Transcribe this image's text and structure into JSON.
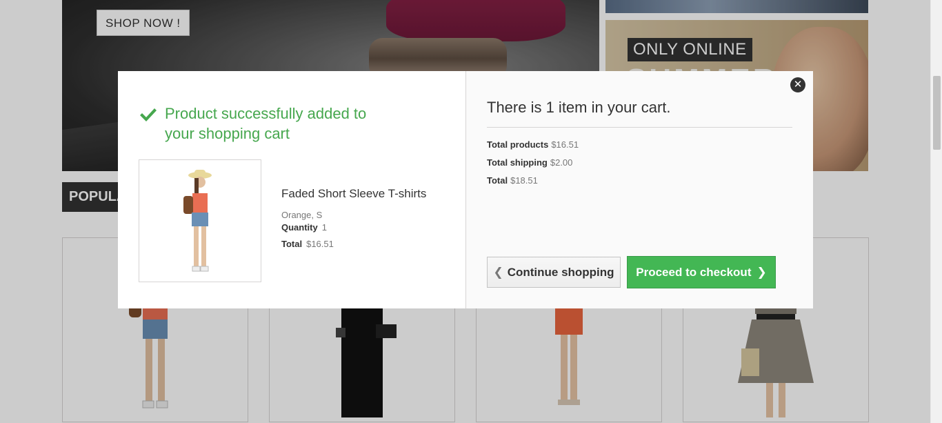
{
  "background": {
    "shop_now_label": "SHOP NOW !",
    "only_online_label": "ONLY ONLINE",
    "summer_label": "SUMMER",
    "popular_tab_label": "POPULAR"
  },
  "modal": {
    "success_message": "Product successfully added to your shopping cart",
    "product": {
      "name": "Faded Short Sleeve T-shirts",
      "attributes": "Orange, S",
      "quantity_label": "Quantity",
      "quantity_value": "1",
      "total_label": "Total",
      "total_value": "$16.51"
    },
    "cart": {
      "title": "There is 1 item in your cart.",
      "total_products_label": "Total products",
      "total_products_value": "$16.51",
      "total_shipping_label": "Total shipping",
      "total_shipping_value": "$2.00",
      "total_label": "Total",
      "total_value": "$18.51"
    },
    "continue_label": "Continue shopping",
    "checkout_label": "Proceed to checkout",
    "close_icon": "close-icon",
    "check_icon": "checkmark-icon"
  },
  "colors": {
    "success_green": "#46a74e",
    "checkout_green": "#43b754",
    "dark_tab": "#333333"
  }
}
